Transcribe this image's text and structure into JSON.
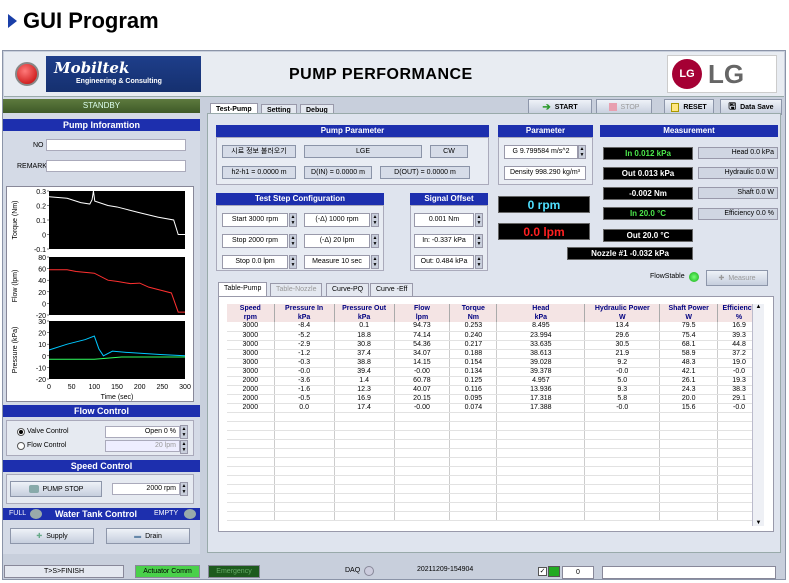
{
  "slide_heading": "GUI Program",
  "logo": {
    "name": "Mobiltek",
    "tagline": "Engineering & Consulting"
  },
  "app_title": "PUMP PERFORMANCE",
  "lg": {
    "circle": "LG",
    "text": "LG"
  },
  "left": {
    "state": "STANDBY",
    "pump_info_title": "Pump Inforamtion",
    "no_label": "NO",
    "no_value": "",
    "remark_label": "REMARK",
    "remark_value": "",
    "flow_control_title": "Flow Control",
    "valve_control": "Valve Control",
    "flow_control": "Flow Control",
    "valve_open": "Open 0 %",
    "flow_lpm": "20 lpm",
    "speed_control_title": "Speed Control",
    "pump_stop": "PUMP STOP",
    "rpm_value": "2000 rpm",
    "full": "FULL",
    "water_tank_title": "Water Tank Control",
    "empty": "EMPTY",
    "supply": "Supply",
    "drain": "Drain"
  },
  "chart": {
    "xlabel": "Time (sec)",
    "xticks": [
      "0",
      "50",
      "100",
      "150",
      "200",
      "250",
      "300"
    ],
    "panels": [
      {
        "ylabel": "Torque (Nm)",
        "yticks": [
          "0.3",
          "0.2",
          "0.1",
          "0",
          "-0.1"
        ],
        "color": "#ffffff"
      },
      {
        "ylabel": "Flow (lpm)",
        "yticks": [
          "80",
          "60",
          "40",
          "20",
          "0",
          "-20"
        ],
        "color": "#ff3030"
      },
      {
        "ylabel": "Pressure (kPa)",
        "yticks": [
          "30",
          "20",
          "10",
          "0",
          "-10",
          "-20"
        ],
        "color": "#00c8ff"
      }
    ]
  },
  "tabs": [
    "Test-Pump",
    "Setting",
    "Debug"
  ],
  "toolbar": {
    "start": "START",
    "stop": "STOP",
    "reset": "RESET",
    "data_save": "Data Save"
  },
  "pump_param": {
    "title": "Pump Parameter",
    "load_info": "시료 정보 불러오기",
    "maker": "LGE",
    "direction": "CW",
    "h2h1": "h2-h1 = 0.0000 m",
    "din": "D(IN) = 0.0000 m",
    "dout": "D(OUT) = 0.0000 m"
  },
  "parameter": {
    "title": "Parameter",
    "g": "G 9.799584 m/s^2",
    "density": "Density 998.290 kg/m³"
  },
  "measurement": {
    "title": "Measurement",
    "in_kpa": "In 0.012 kPa",
    "out_kpa": "Out 0.013 kPa",
    "torque": "-0.002 Nm",
    "in_temp": "In 20.0 °C",
    "out_temp": "Out 20.0 °C",
    "nozzle": "Nozzle #1 -0.032 kPa",
    "head": "Head 0.0 kPa",
    "hydraulic": "Hydraulic 0.0 W",
    "shaft": "Shaft 0.0 W",
    "efficiency": "Efficiency 0.0 %"
  },
  "test_step": {
    "title": "Test Step Configuration",
    "start": "Start 3000 rpm",
    "delta_rpm": "(-Δ) 1000 rpm",
    "stop": "Stop 2000 rpm",
    "delta_lpm": "(-Δ) 20 lpm",
    "stop_lpm": "Stop 0.0 lpm",
    "measure": "Measure 10 sec"
  },
  "signal_offset": {
    "title": "Signal Offset",
    "nm": "0.001 Nm",
    "in": "In: -0.337 kPa",
    "out": "Out: 0.484 kPa"
  },
  "big": {
    "rpm": "0 rpm",
    "lpm": "0.0 lpm"
  },
  "flowstable": "FlowStable",
  "measure_btn": "Measure",
  "subtabs": [
    "Table-Pump",
    "Table-Nozzle",
    "Curve-PQ",
    "Curve -Eff"
  ],
  "table": {
    "headers": [
      [
        "Speed",
        "rpm"
      ],
      [
        "Pressure In",
        "kPa"
      ],
      [
        "Pressure Out",
        "kPa"
      ],
      [
        "Flow",
        "lpm"
      ],
      [
        "Torque",
        "Nm"
      ],
      [
        "Head",
        "kPa"
      ],
      [
        "Hydraulic Power",
        "W"
      ],
      [
        "Shaft Power",
        "W"
      ],
      [
        "Efficiency",
        "%"
      ]
    ],
    "rows": [
      [
        "3000",
        "-8.4",
        "0.1",
        "94.73",
        "0.253",
        "8.495",
        "13.4",
        "79.5",
        "16.9"
      ],
      [
        "3000",
        "-5.2",
        "18.8",
        "74.14",
        "0.240",
        "23.994",
        "29.6",
        "75.4",
        "39.3"
      ],
      [
        "3000",
        "-2.9",
        "30.8",
        "54.36",
        "0.217",
        "33.635",
        "30.5",
        "68.1",
        "44.8"
      ],
      [
        "3000",
        "-1.2",
        "37.4",
        "34.07",
        "0.188",
        "38.613",
        "21.9",
        "58.9",
        "37.2"
      ],
      [
        "3000",
        "-0.3",
        "38.8",
        "14.15",
        "0.154",
        "39.028",
        "9.2",
        "48.3",
        "19.0"
      ],
      [
        "3000",
        "-0.0",
        "39.4",
        "-0.00",
        "0.134",
        "39.378",
        "-0.0",
        "42.1",
        "-0.0"
      ],
      [
        "2000",
        "-3.6",
        "1.4",
        "60.78",
        "0.125",
        "4.957",
        "5.0",
        "26.1",
        "19.3"
      ],
      [
        "2000",
        "-1.6",
        "12.3",
        "40.07",
        "0.116",
        "13.936",
        "9.3",
        "24.3",
        "38.3"
      ],
      [
        "2000",
        "-0.5",
        "16.9",
        "20.15",
        "0.095",
        "17.318",
        "5.8",
        "20.0",
        "29.1"
      ],
      [
        "2000",
        "0.0",
        "17.4",
        "-0.00",
        "0.074",
        "17.388",
        "-0.0",
        "15.6",
        "-0.0"
      ]
    ]
  },
  "statusbar": {
    "finish": "T>S>FINISH",
    "comm": "Actuator Comm",
    "emergency": "Emergency",
    "daq": "DAQ",
    "timestamp": "20211209-154904",
    "count": "0"
  }
}
